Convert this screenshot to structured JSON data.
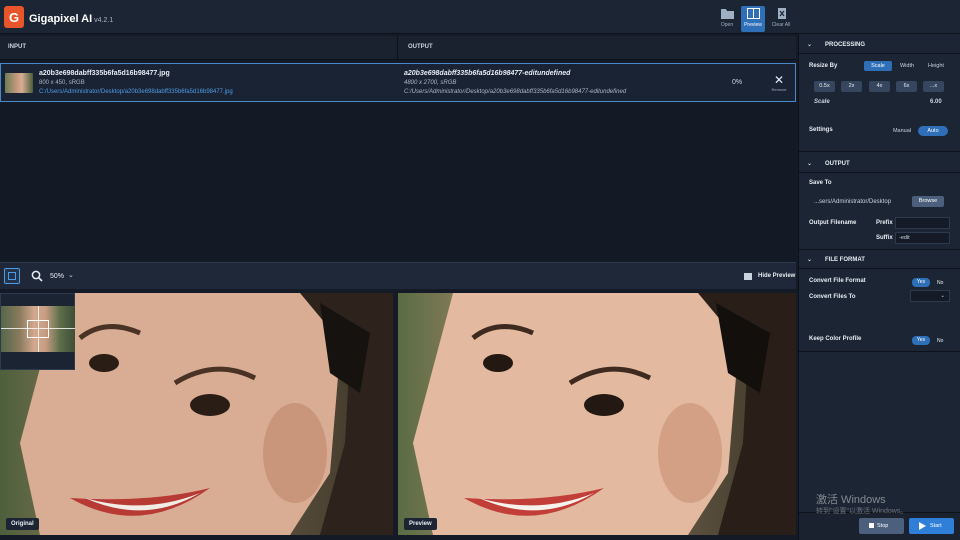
{
  "app": {
    "title": "Gigapixel AI",
    "version": "v4.2.1",
    "logo": "G"
  },
  "toolbar": {
    "open": "Open",
    "preview": "Preview",
    "clear_all": "Clear All"
  },
  "file_list": {
    "input_header": "INPUT",
    "output_header": "OUTPUT",
    "row": {
      "input_name": "a20b3e698dabff335b6fa5d16b98477.jpg",
      "input_size": "800 x 450, sRGB",
      "input_path": "C:/Users/Administrator/Desktop/a20b3e698dabff335b6fa5d16b98477.jpg",
      "output_name": "a20b3e698dabff335b6fa5d16b98477-editundefined",
      "output_size": "4800 x 2700, sRGB",
      "output_path": "C:/Users/Administrator/Desktop/a20b3e698dabff335b6fa5d16b98477-editundefined",
      "progress": "0%",
      "remove_label": "Remove"
    }
  },
  "preview_bar": {
    "zoom": "50%",
    "hide_preview": "Hide Preview"
  },
  "panes": {
    "original_label": "Original",
    "preview_label": "Preview"
  },
  "processing": {
    "header": "PROCESSING",
    "resize_by_label": "Resize By",
    "resize_options": [
      "Scale",
      "Width",
      "Height"
    ],
    "resize_selected": "Scale",
    "scale_buttons": [
      "0.5x",
      "2x",
      "4x",
      "6x",
      "...x"
    ],
    "scale_label": "Scale",
    "scale_value": "6.00",
    "settings_label": "Settings",
    "settings_options": [
      "Manual",
      "Auto"
    ],
    "settings_selected": "Auto"
  },
  "output": {
    "header": "OUTPUT",
    "save_to_label": "Save To",
    "save_to_value": "...sers/Administrator/Desktop",
    "browse": "Browse",
    "filename_label": "Output Filename",
    "prefix_label": "Prefix",
    "prefix_value": "",
    "suffix_label": "Suffix",
    "suffix_value": "-edit"
  },
  "file_format": {
    "header": "FILE FORMAT",
    "convert_label": "Convert File Format",
    "convert_to_label": "Convert Files To",
    "keep_color_label": "Keep Color Profile",
    "yes": "Yes",
    "no": "No"
  },
  "actions": {
    "stop": "Stop",
    "start": "Start"
  },
  "watermark": {
    "line1": "激活 Windows",
    "line2": "转到\"设置\"以激活 Windows。"
  },
  "colors": {
    "accent": "#2f6fb7",
    "background": "#141b26",
    "panel": "#1c2533"
  }
}
